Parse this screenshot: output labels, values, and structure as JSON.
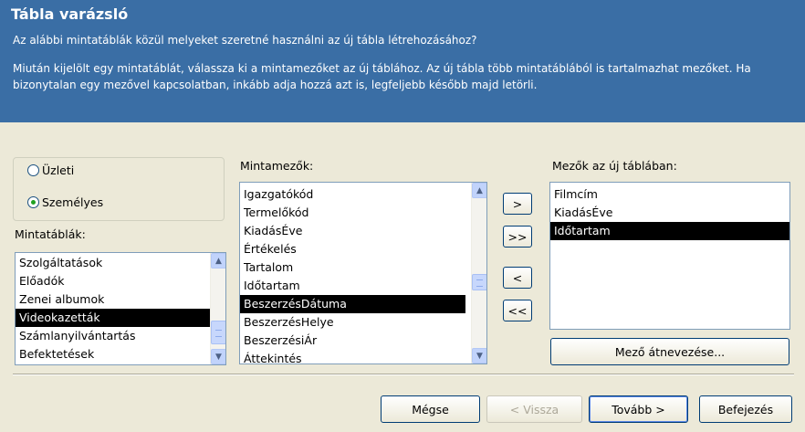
{
  "window": {
    "title": "Tábla varázsló",
    "question": "Az alábbi mintatáblák közül melyeket szeretné használni az új tábla létrehozásához?",
    "hint": "Miután kijelölt egy mintatáblát, válassza ki a mintamezőket az új táblához. Az új tábla több mintatáblából is tartalmazhat mezőket. Ha bizonytalan egy mezővel kapcsolatban, inkább adja hozzá azt is, legfeljebb később majd letörli."
  },
  "category": {
    "options": [
      {
        "label": "Üzleti",
        "selected": false
      },
      {
        "label": "Személyes",
        "selected": true
      }
    ]
  },
  "sample_tables": {
    "label": "Mintatáblák:",
    "items": [
      "Szolgáltatások",
      "Előadók",
      "Zenei albumok",
      "Videokazetták",
      "Számlanyilvántartás",
      "Befektetések"
    ],
    "selected": "Videokazetták"
  },
  "sample_fields": {
    "label": "Mintamezők:",
    "items": [
      "Igazgatókód",
      "Termelőkód",
      "KiadásÉve",
      "Értékelés",
      "Tartalom",
      "Időtartam",
      "BeszerzésDátuma",
      "BeszerzésHelye",
      "BeszerzésiÁr",
      "Áttekintés"
    ],
    "selected": "BeszerzésDátuma"
  },
  "move_buttons": {
    "add_one": ">",
    "add_all": ">>",
    "remove_one": "<",
    "remove_all": "<<"
  },
  "new_fields": {
    "label": "Mezők az új táblában:",
    "items": [
      "Filmcím",
      "KiadásÉve",
      "Időtartam"
    ],
    "selected": "Időtartam"
  },
  "rename_button": "Mező átnevezése...",
  "footer": {
    "cancel": "Mégse",
    "back": "< Vissza",
    "next": "Tovább >",
    "finish": "Befejezés"
  },
  "colors": {
    "header_bg": "#3a6ea5",
    "dialog_bg": "#ece9d8",
    "selection_bg": "#000000"
  }
}
